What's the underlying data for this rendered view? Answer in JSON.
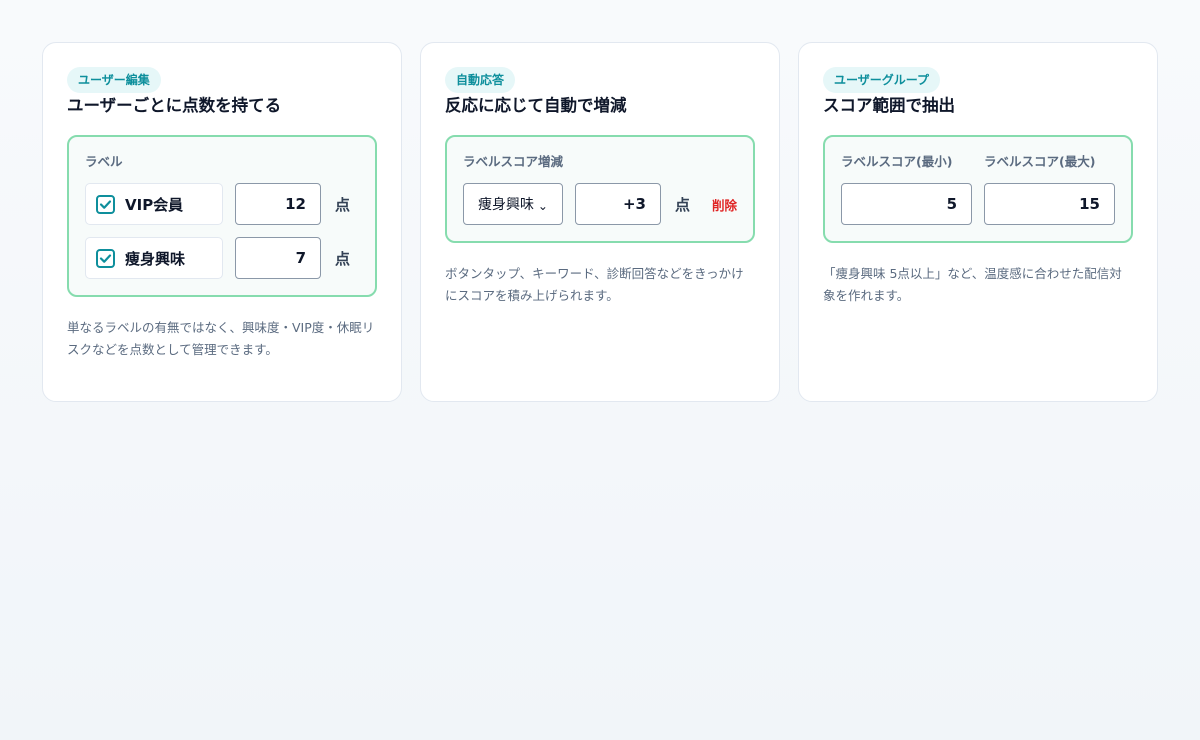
{
  "cards": [
    {
      "badge": "ユーザー編集",
      "title": "ユーザーごとに点数を持てる",
      "panel_label": "ラベル",
      "rows": [
        {
          "label": "VIP会員",
          "checked": true,
          "value": "12",
          "unit": "点"
        },
        {
          "label": "痩身興味",
          "checked": true,
          "value": "7",
          "unit": "点"
        }
      ],
      "description": "単なるラベルの有無ではなく、興味度・VIP度・休眠リスクなどを点数として管理できます。"
    },
    {
      "badge": "自動応答",
      "title": "反応に応じて自動で増減",
      "panel_label": "ラベルスコア増減",
      "select_value": "痩身興味",
      "delta_value": "+3",
      "unit": "点",
      "delete_label": "削除",
      "description": "ボタンタップ、キーワード、診断回答などをきっかけにスコアを積み上げられます。"
    },
    {
      "badge": "ユーザーグループ",
      "title": "スコア範囲で抽出",
      "min_label": "ラベルスコア(最小)",
      "max_label": "ラベルスコア(最大)",
      "min_value": "5",
      "max_value": "15",
      "description": "「痩身興味 5点以上」など、温度感に合わせた配信対象を作れます。"
    }
  ],
  "colors": {
    "accent": "#0e8f9c",
    "panel_border": "#86dcae",
    "delete": "#e02424"
  },
  "icons": {
    "checkbox": "check-icon",
    "select": "chevron-down-icon"
  }
}
